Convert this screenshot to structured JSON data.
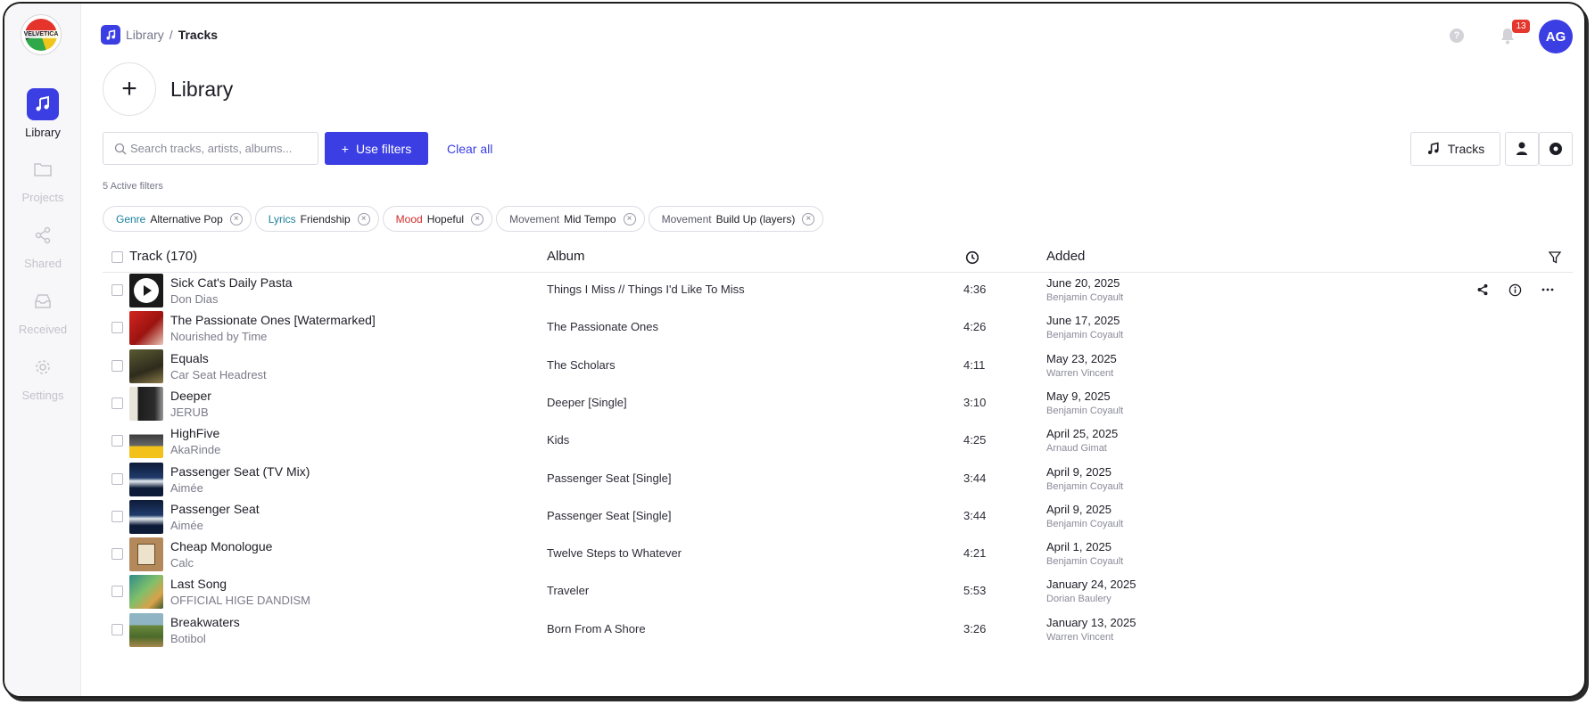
{
  "sidebar": {
    "logo_text": "VELVETICA",
    "items": [
      {
        "label": "Library",
        "icon": "music-note-icon",
        "active": true
      },
      {
        "label": "Projects",
        "icon": "folder-icon"
      },
      {
        "label": "Shared",
        "icon": "share-icon"
      },
      {
        "label": "Received",
        "icon": "inbox-icon"
      },
      {
        "label": "Settings",
        "icon": "gear-icon"
      }
    ]
  },
  "header": {
    "breadcrumb": {
      "root": "Library",
      "separator": "/",
      "current": "Tracks"
    },
    "help_glyph": "?",
    "notification_count": "13",
    "avatar_initials": "AG"
  },
  "page": {
    "title": "Library",
    "add_glyph": "+"
  },
  "toolbar": {
    "search_placeholder": "Search tracks, artists, albums...",
    "filters_label": "Use filters",
    "filters_glyph": "+",
    "clear_label": "Clear all",
    "view_tracks_label": "Tracks"
  },
  "filters": {
    "active_text": "5 Active filters",
    "chips": [
      {
        "category": "Genre",
        "value": "Alternative Pop",
        "color": "#1a7f9b"
      },
      {
        "category": "Lyrics",
        "value": "Friendship",
        "color": "#1a7f9b"
      },
      {
        "category": "Mood",
        "value": "Hopeful",
        "color": "#d02b2b"
      },
      {
        "category": "Movement",
        "value": "Mid Tempo",
        "color": "#5a5a6a"
      },
      {
        "category": "Movement",
        "value": "Build Up (layers)",
        "color": "#5a5a6a"
      }
    ]
  },
  "table": {
    "columns": {
      "track": "Track (170)",
      "album": "Album",
      "added": "Added"
    },
    "rows": [
      {
        "title": "Sick Cat's Daily Pasta",
        "artist": "Don Dias",
        "album": "Things I Miss // Things I'd Like To Miss",
        "duration": "4:36",
        "date": "June 20, 2025",
        "user": "Benjamin Coyault",
        "cover": "play",
        "actions": true
      },
      {
        "title": "The Passionate Ones [Watermarked]",
        "artist": "Nourished by Time",
        "album": "The Passionate Ones",
        "duration": "4:26",
        "date": "June 17, 2025",
        "user": "Benjamin Coyault",
        "cover": "red"
      },
      {
        "title": "Equals",
        "artist": "Car Seat Headrest",
        "album": "The Scholars",
        "duration": "4:11",
        "date": "May 23, 2025",
        "user": "Warren Vincent",
        "cover": "olive"
      },
      {
        "title": "Deeper",
        "artist": "JERUB",
        "album": "Deeper [Single]",
        "duration": "3:10",
        "date": "May 9, 2025",
        "user": "Benjamin Coyault",
        "cover": "dark"
      },
      {
        "title": "HighFive",
        "artist": "AkaRinde",
        "album": "Kids",
        "duration": "4:25",
        "date": "April 25, 2025",
        "user": "Arnaud Gimat",
        "cover": "yellow"
      },
      {
        "title": "Passenger Seat (TV Mix)",
        "artist": "Aimée",
        "album": "Passenger Seat [Single]",
        "duration": "3:44",
        "date": "April 9, 2025",
        "user": "Benjamin Coyault",
        "cover": "blue"
      },
      {
        "title": "Passenger Seat",
        "artist": "Aimée",
        "album": "Passenger Seat [Single]",
        "duration": "3:44",
        "date": "April 9, 2025",
        "user": "Benjamin Coyault",
        "cover": "blue"
      },
      {
        "title": "Cheap Monologue",
        "artist": "Calc",
        "album": "Twelve Steps to Whatever",
        "duration": "4:21",
        "date": "April 1, 2025",
        "user": "Benjamin Coyault",
        "cover": "tan"
      },
      {
        "title": "Last Song",
        "artist": "OFFICIAL HIGE DANDISM",
        "album": "Traveler",
        "duration": "5:53",
        "date": "January 24, 2025",
        "user": "Dorian Baulery",
        "cover": "green"
      },
      {
        "title": "Breakwaters",
        "artist": "Botibol",
        "album": "Born From A Shore",
        "duration": "3:26",
        "date": "January 13, 2025",
        "user": "Warren Vincent",
        "cover": "landscape"
      }
    ]
  },
  "colors": {
    "accent": "#3b3ee2",
    "badge": "#e5372e",
    "muted": "#7b7b8b"
  }
}
